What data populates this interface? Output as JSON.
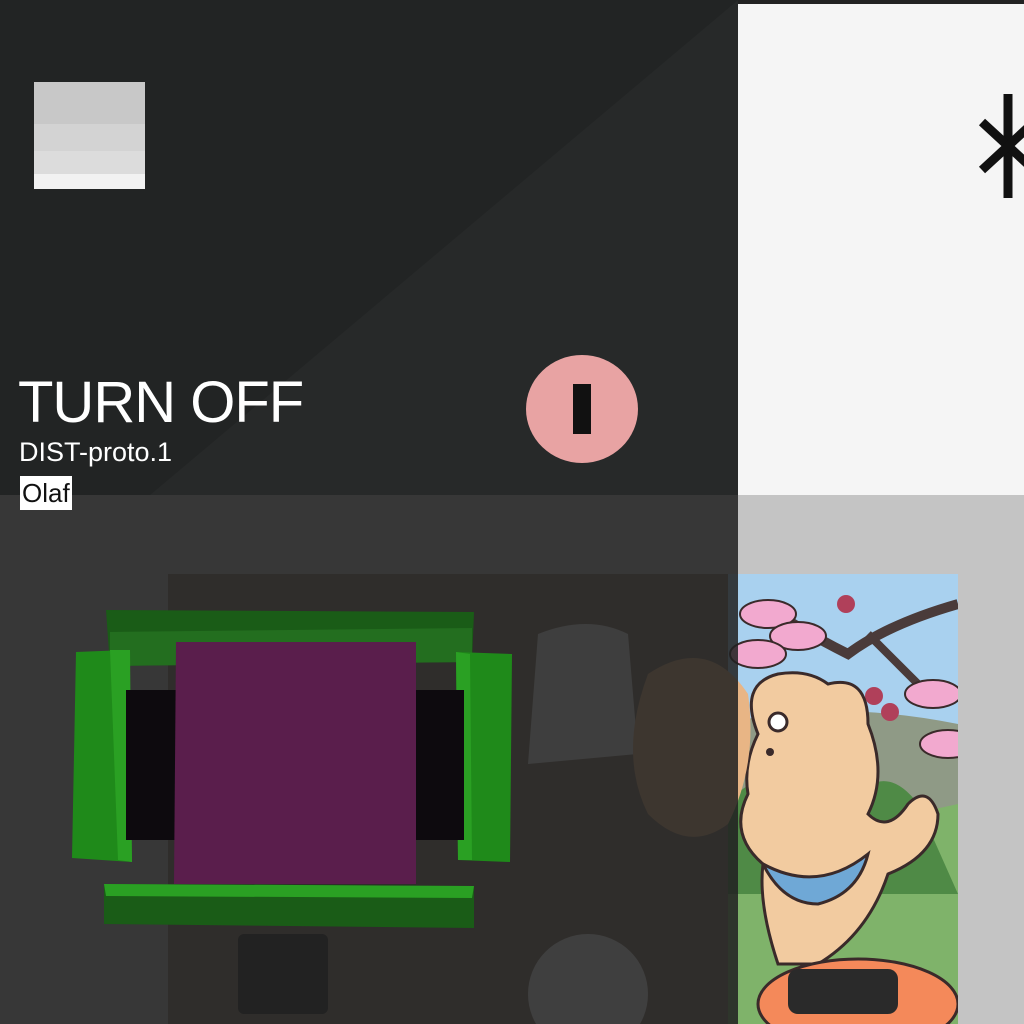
{
  "control": {
    "title": "TURN OFF",
    "device": "DIST-proto.1",
    "owner": "Olaf",
    "button_icon": "power-off-icon"
  },
  "colors": {
    "overlay": "#222424",
    "power_button": "#e8a3a3",
    "frame_green": "#1f8a1a",
    "frame_purple": "#5a1e4c"
  },
  "icons": {
    "asterisk": "asterisk-icon",
    "thumbnail": "thumbnail-image",
    "artwork": "shiba-sakura-illustration"
  }
}
